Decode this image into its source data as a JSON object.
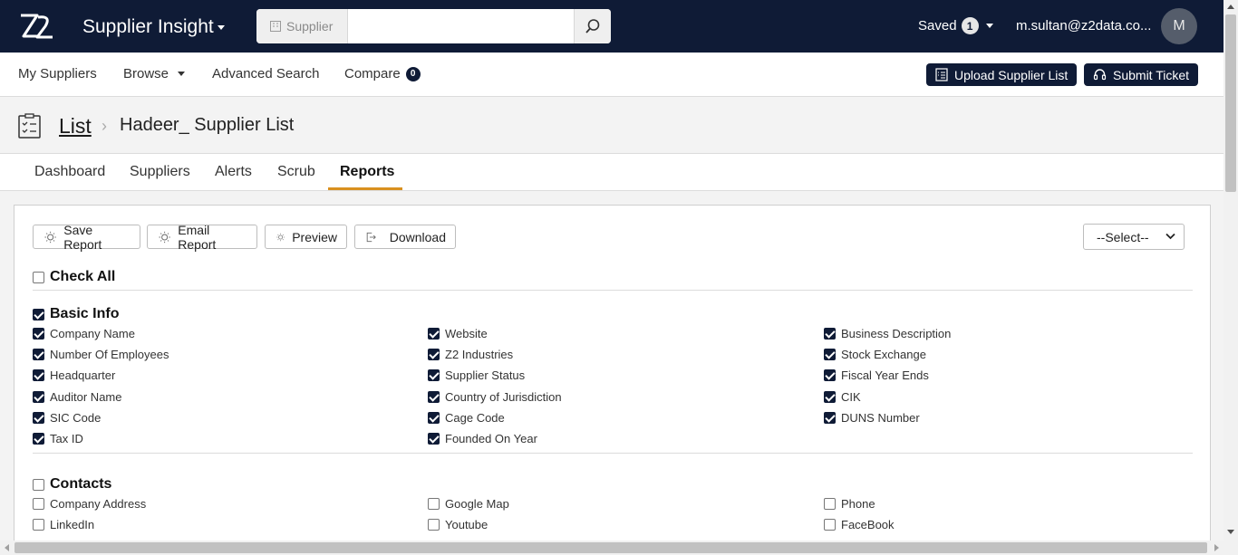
{
  "header": {
    "app_title": "Supplier Insight",
    "search_scope": "Supplier",
    "search_placeholder": "",
    "saved_label": "Saved",
    "saved_count": "1",
    "user_email": "m.sultan@z2data.co...",
    "avatar_initial": "M"
  },
  "subnav": {
    "my_suppliers": "My Suppliers",
    "browse": "Browse",
    "advanced_search": "Advanced Search",
    "compare": "Compare",
    "compare_count": "0",
    "upload_button": "Upload Supplier List",
    "submit_ticket_button": "Submit Ticket"
  },
  "breadcrumb": {
    "root": "List",
    "current": "Hadeer_ Supplier List"
  },
  "tabs": [
    "Dashboard",
    "Suppliers",
    "Alerts",
    "Scrub",
    "Reports"
  ],
  "active_tab": "Reports",
  "toolbar": {
    "save_report": "Save Report",
    "email_report": "Email Report",
    "preview": "Preview",
    "download": "Download",
    "select_value": "--Select--"
  },
  "check_all": {
    "label": "Check All",
    "checked": false
  },
  "basic_info": {
    "title": "Basic Info",
    "checked": true,
    "columns": [
      [
        "Company Name",
        "Number Of Employees",
        "Headquarter",
        "Auditor Name",
        "SIC Code",
        "Tax ID"
      ],
      [
        "Website",
        "Z2 Industries",
        "Supplier Status",
        "Country of Jurisdiction",
        "Cage Code",
        "Founded On Year"
      ],
      [
        "Business Description",
        "Stock Exchange",
        "Fiscal Year Ends",
        "CIK",
        "DUNS Number"
      ]
    ]
  },
  "contacts": {
    "title": "Contacts",
    "checked": false,
    "columns": [
      [
        "Company Address",
        "LinkedIn"
      ],
      [
        "Google Map",
        "Youtube"
      ],
      [
        "Phone",
        "FaceBook"
      ]
    ]
  },
  "colors": {
    "navy": "#0f1b36",
    "accent": "#d9901f"
  }
}
